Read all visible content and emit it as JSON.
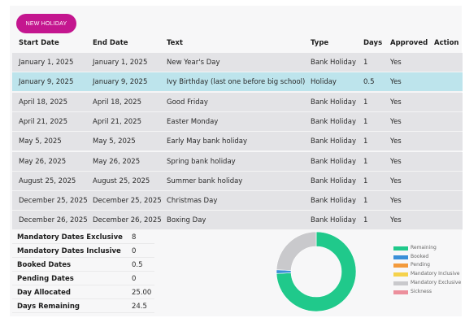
{
  "toolbar": {
    "new_holiday_label": "NEW HOLIDAY"
  },
  "table": {
    "headers": {
      "start_date": "Start Date",
      "end_date": "End Date",
      "text": "Text",
      "type": "Type",
      "days": "Days",
      "approved": "Approved",
      "action": "Action"
    },
    "rows": [
      {
        "start": "January 1, 2025",
        "end": "January 1, 2025",
        "text": "New Year's Day",
        "type": "Bank Holiday",
        "days": "1",
        "approved": "Yes",
        "highlighted": false
      },
      {
        "start": "January 9, 2025",
        "end": "January 9, 2025",
        "text": "Ivy Birthday (last one before big school)",
        "type": "Holiday",
        "days": "0.5",
        "approved": "Yes",
        "highlighted": true
      },
      {
        "start": "April 18, 2025",
        "end": "April 18, 2025",
        "text": "Good Friday",
        "type": "Bank Holiday",
        "days": "1",
        "approved": "Yes",
        "highlighted": false
      },
      {
        "start": "April 21, 2025",
        "end": "April 21, 2025",
        "text": "Easter Monday",
        "type": "Bank Holiday",
        "days": "1",
        "approved": "Yes",
        "highlighted": false
      },
      {
        "start": "May 5, 2025",
        "end": "May 5, 2025",
        "text": "Early May bank holiday",
        "type": "Bank Holiday",
        "days": "1",
        "approved": "Yes",
        "highlighted": false
      },
      {
        "start": "May 26, 2025",
        "end": "May 26, 2025",
        "text": "Spring bank holiday",
        "type": "Bank Holiday",
        "days": "1",
        "approved": "Yes",
        "highlighted": false
      },
      {
        "start": "August 25, 2025",
        "end": "August 25, 2025",
        "text": "Summer bank holiday",
        "type": "Bank Holiday",
        "days": "1",
        "approved": "Yes",
        "highlighted": false
      },
      {
        "start": "December 25, 2025",
        "end": "December 25, 2025",
        "text": "Christmas Day",
        "type": "Bank Holiday",
        "days": "1",
        "approved": "Yes",
        "highlighted": false
      },
      {
        "start": "December 26, 2025",
        "end": "December 26, 2025",
        "text": "Boxing Day",
        "type": "Bank Holiday",
        "days": "1",
        "approved": "Yes",
        "highlighted": false
      }
    ]
  },
  "summary": [
    {
      "label": "Mandatory Dates Exclusive",
      "value": "8"
    },
    {
      "label": "Mandatory Dates Inclusive",
      "value": "0"
    },
    {
      "label": "Booked Dates",
      "value": "0.5"
    },
    {
      "label": "Pending Dates",
      "value": "0"
    },
    {
      "label": "Day Allocated",
      "value": "25.00"
    },
    {
      "label": "Days Remaining",
      "value": "24.5"
    }
  ],
  "chart_data": {
    "type": "pie",
    "donut": true,
    "categories": [
      "Remaining",
      "Booked",
      "Pending",
      "Mandatory Inclusive",
      "Mandatory Exclusive",
      "Sickness"
    ],
    "values": [
      24.5,
      0.5,
      0,
      0,
      8,
      0
    ],
    "colors": [
      "#20c98b",
      "#3a8fd8",
      "#f39a3c",
      "#f5d24c",
      "#c9c9cc",
      "#ec8f9c"
    ],
    "legend_position": "right"
  },
  "colors": {
    "accent": "#c4168f",
    "row_background": "#e3e3e6",
    "row_highlight": "#bde4ec"
  }
}
